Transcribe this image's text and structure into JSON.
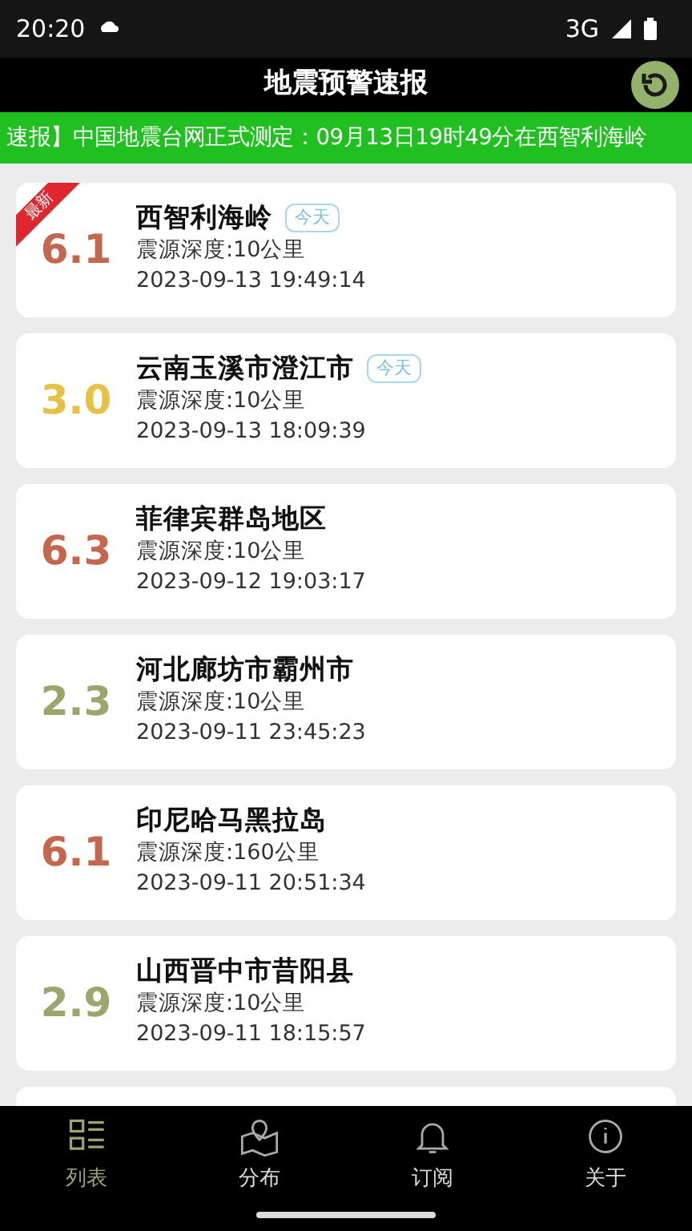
{
  "status_bar": {
    "time": "20:20",
    "network": "3G"
  },
  "header": {
    "title": "地震预警速报"
  },
  "ticker": {
    "text": "速报】中国地震台网正式测定：09月13日19时49分在西智利海岭"
  },
  "quakes": [
    {
      "magnitude": "6.1",
      "color": "#c5664f",
      "place": "西智利海岭",
      "tag": "今天",
      "newest_label": "最新",
      "depth": "震源深度:10公里",
      "time": "2023-09-13 19:49:14"
    },
    {
      "magnitude": "3.0",
      "color": "#e6c145",
      "place": "云南玉溪市澄江市",
      "tag": "今天",
      "depth": "震源深度:10公里",
      "time": "2023-09-13 18:09:39"
    },
    {
      "magnitude": "6.3",
      "color": "#c5664f",
      "place": "菲律宾群岛地区",
      "depth": "震源深度:10公里",
      "time": "2023-09-12 19:03:17"
    },
    {
      "magnitude": "2.3",
      "color": "#9aa66c",
      "place": "河北廊坊市霸州市",
      "depth": "震源深度:10公里",
      "time": "2023-09-11 23:45:23"
    },
    {
      "magnitude": "6.1",
      "color": "#c5664f",
      "place": "印尼哈马黑拉岛",
      "depth": "震源深度:160公里",
      "time": "2023-09-11 20:51:34"
    },
    {
      "magnitude": "2.9",
      "color": "#9aa66c",
      "place": "山西晋中市昔阳县",
      "depth": "震源深度:10公里",
      "time": "2023-09-11 18:15:57"
    }
  ],
  "tabs": [
    {
      "label": "列表",
      "kind": "list",
      "selected": true
    },
    {
      "label": "分布",
      "kind": "map",
      "selected": false
    },
    {
      "label": "订阅",
      "kind": "bell",
      "selected": false
    },
    {
      "label": "关于",
      "kind": "info",
      "selected": false
    }
  ]
}
